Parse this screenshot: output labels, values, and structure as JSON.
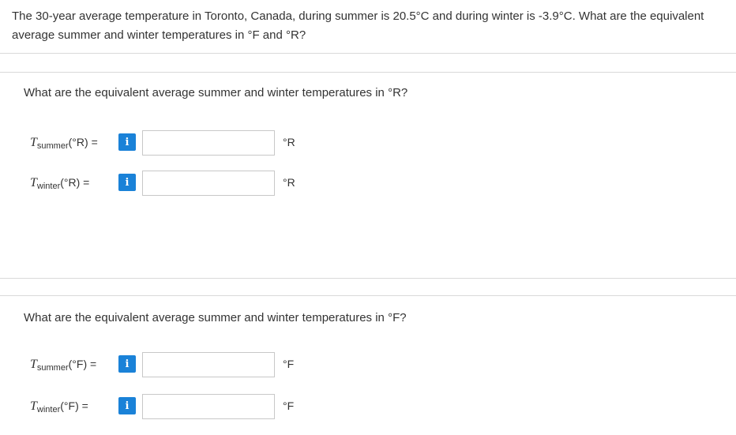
{
  "intro": {
    "text": "The 30-year average temperature in Toronto, Canada, during summer is 20.5°C and during winter is -3.9°C. What are the equivalent average summer and winter temperatures in °F and °R?"
  },
  "part_rankine": {
    "question": "What are the equivalent average summer and winter temperatures in °R?",
    "rows": [
      {
        "symbol": "T",
        "subscript": "summer",
        "suffix": "(°R) =",
        "value": "",
        "unit": "°R"
      },
      {
        "symbol": "T",
        "subscript": "winter",
        "suffix": "(°R) =",
        "value": "",
        "unit": "°R"
      }
    ]
  },
  "part_fahrenheit": {
    "question": "What are the equivalent average summer and winter temperatures in °F?",
    "rows": [
      {
        "symbol": "T",
        "subscript": "summer",
        "suffix": "(°F) =",
        "value": "",
        "unit": "°F"
      },
      {
        "symbol": "T",
        "subscript": "winter",
        "suffix": "(°F) =",
        "value": "",
        "unit": "°F"
      }
    ]
  },
  "info_icon_label": "i",
  "colors": {
    "info_button": "#1a82d8",
    "divider": "#d9d9d9",
    "text": "#333333"
  }
}
